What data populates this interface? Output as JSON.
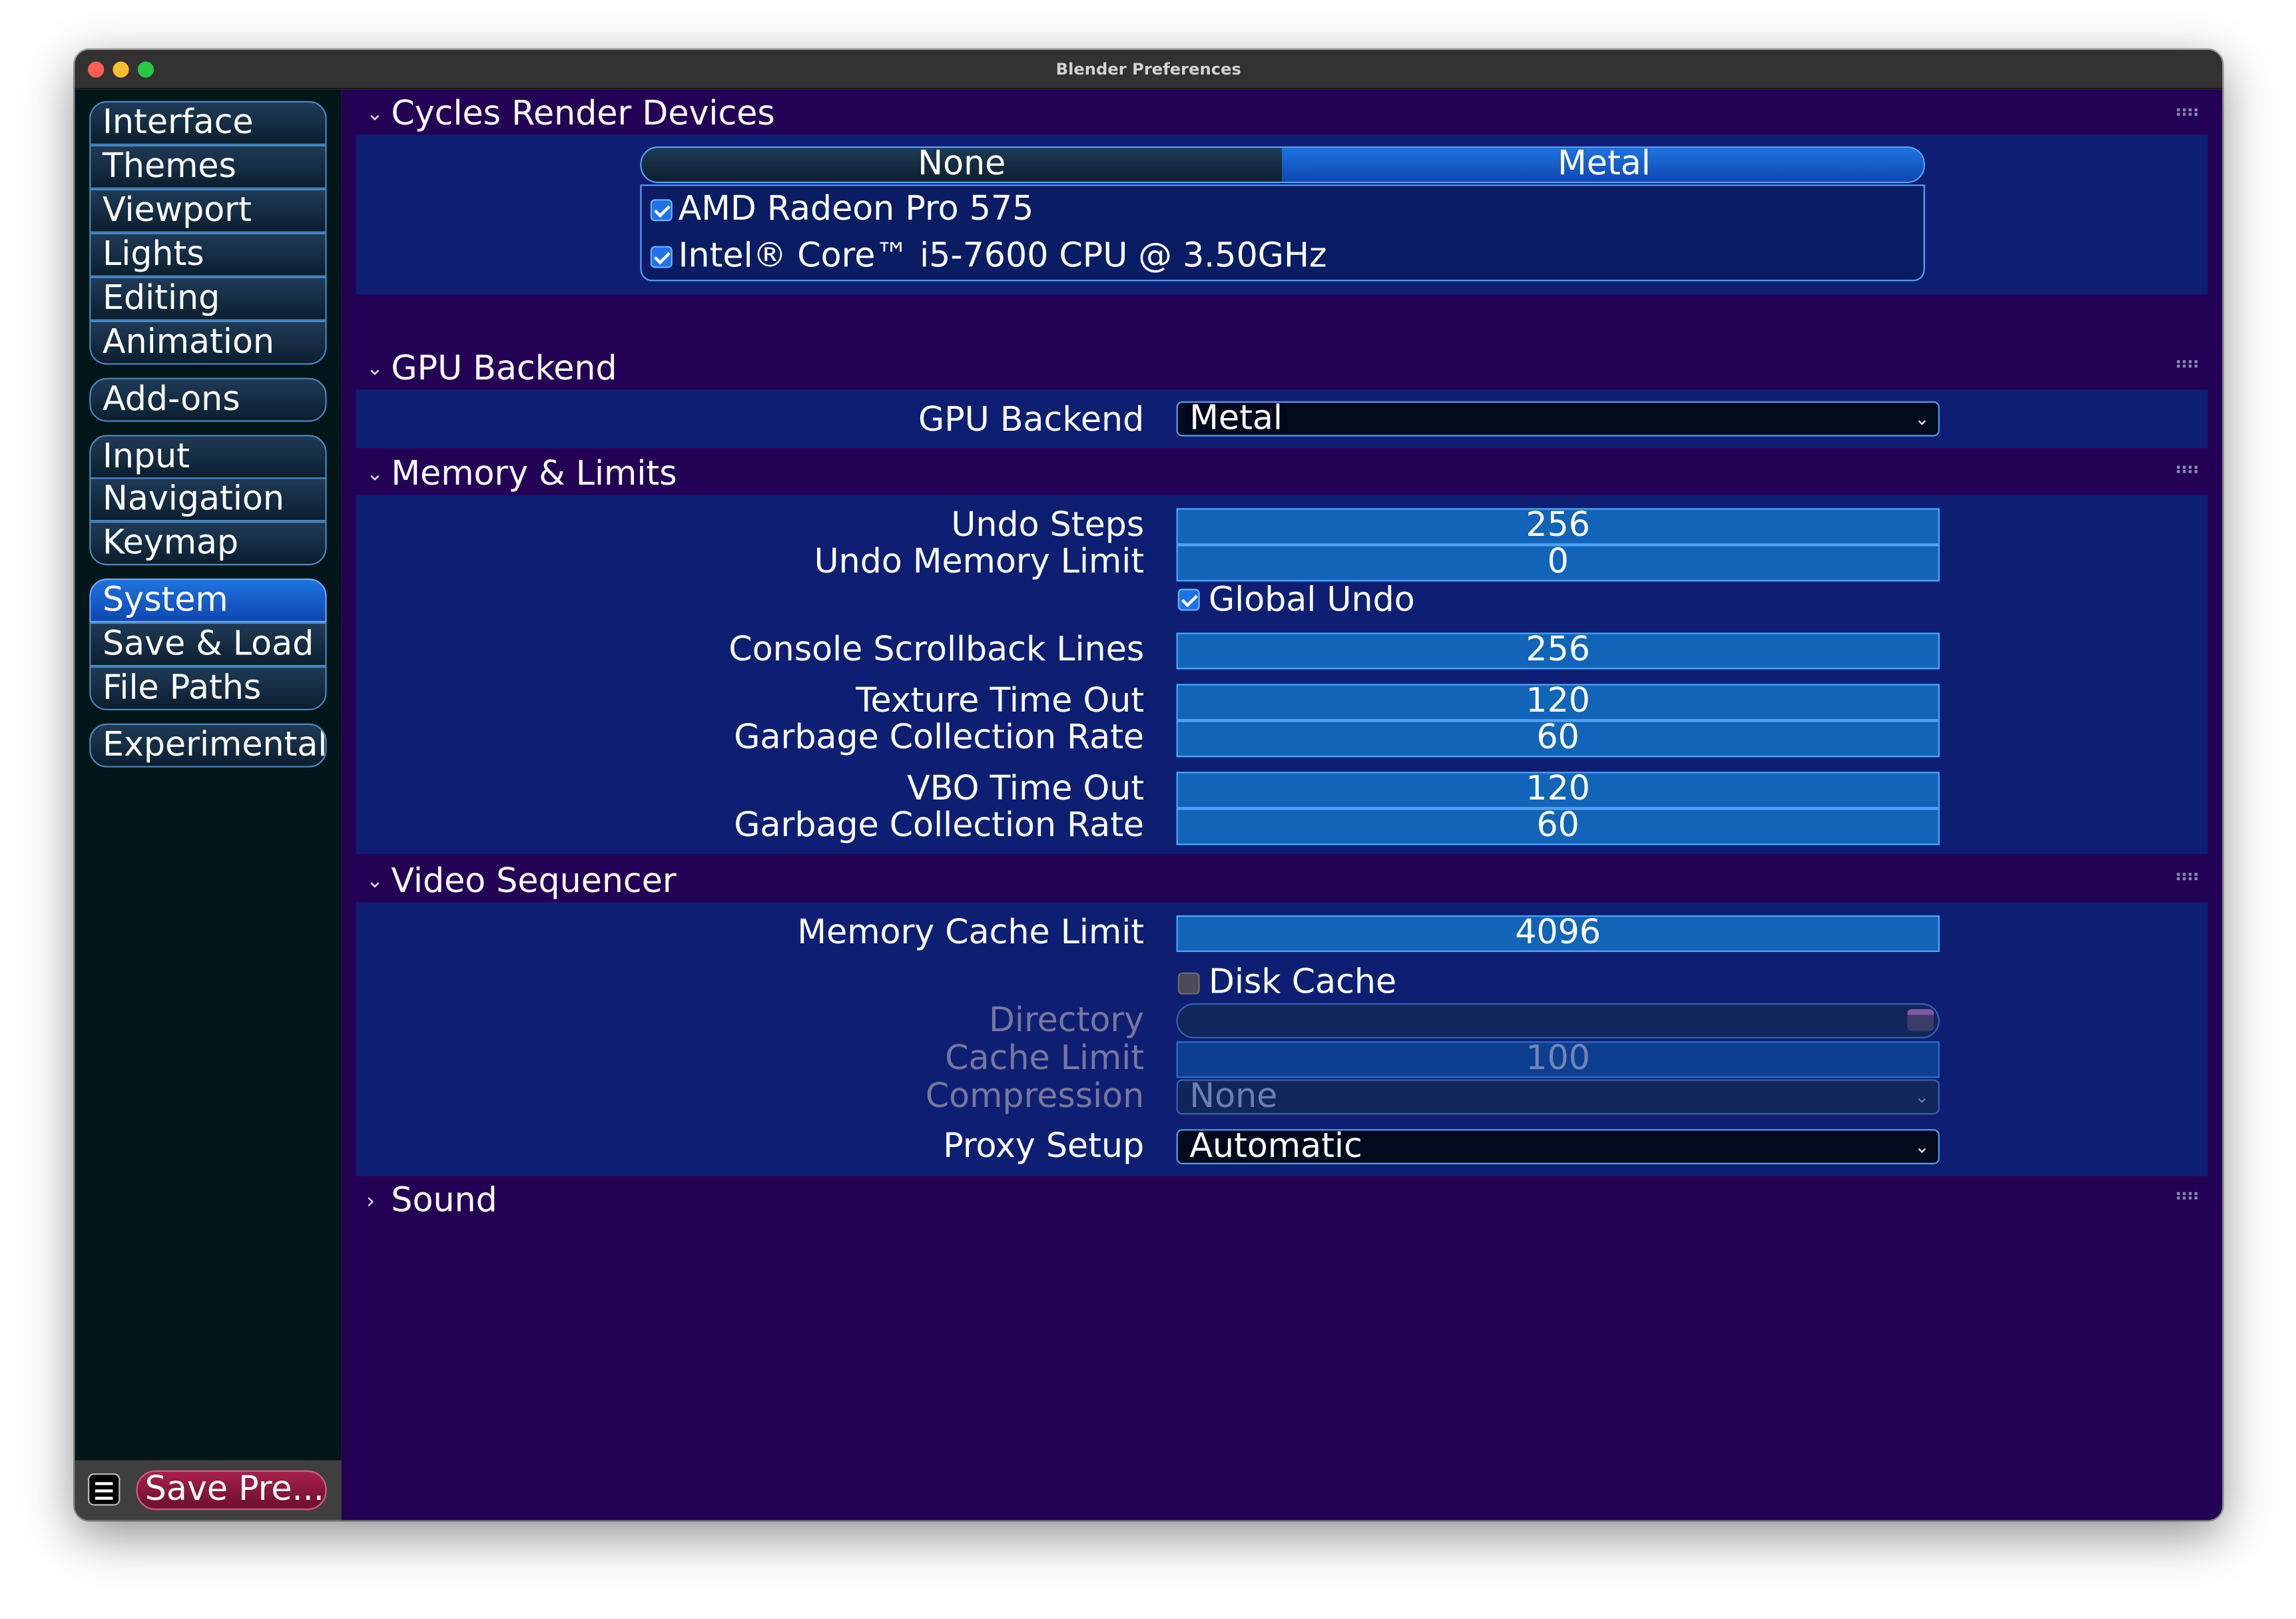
{
  "window": {
    "title": "Blender Preferences"
  },
  "sidebar": {
    "items": [
      "Interface",
      "Themes",
      "Viewport",
      "Lights",
      "Editing",
      "Animation",
      "Add-ons",
      "Input",
      "Navigation",
      "Keymap",
      "System",
      "Save & Load",
      "File Paths",
      "Experimental"
    ],
    "active": "System",
    "save_label": "Save Pre..."
  },
  "cycles": {
    "title": "Cycles Render Devices",
    "tabs": [
      "None",
      "Metal"
    ],
    "selected_tab": "Metal",
    "devices": [
      {
        "name": "AMD Radeon Pro 575",
        "checked": true
      },
      {
        "name": "Intel® Core™ i5-7600 CPU @ 3.50GHz",
        "checked": true
      }
    ]
  },
  "gpu": {
    "title": "GPU Backend",
    "label": "GPU Backend",
    "value": "Metal"
  },
  "memory": {
    "title": "Memory & Limits",
    "undo_steps_label": "Undo Steps",
    "undo_steps": "256",
    "undo_memory_label": "Undo Memory Limit",
    "undo_memory": "0",
    "global_undo_label": "Global Undo",
    "global_undo": true,
    "console_label": "Console Scrollback Lines",
    "console": "256",
    "texture_label": "Texture Time Out",
    "texture": "120",
    "gc_label": "Garbage Collection Rate",
    "texture_gc": "60",
    "vbo_label": "VBO Time Out",
    "vbo": "120",
    "vbo_gc": "60"
  },
  "video": {
    "title": "Video Sequencer",
    "mem_cache_label": "Memory Cache Limit",
    "mem_cache": "4096",
    "disk_cache_label": "Disk Cache",
    "disk_cache": false,
    "directory_label": "Directory",
    "directory": "",
    "cache_limit_label": "Cache Limit",
    "cache_limit": "100",
    "compression_label": "Compression",
    "compression": "None",
    "proxy_label": "Proxy Setup",
    "proxy": "Automatic"
  },
  "sound": {
    "title": "Sound"
  }
}
